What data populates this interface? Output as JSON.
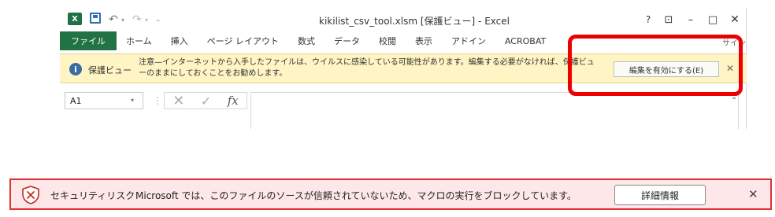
{
  "window": {
    "title": "kikilist_csv_tool.xlsm  [保護ビュー] - Excel",
    "help": "?",
    "ribbon_options": "⊡",
    "minimize": "–",
    "maximize": "□",
    "close": "✕"
  },
  "qat": {
    "app_icon": "X",
    "undo": "↶",
    "redo": "↷",
    "dropdown": "▾",
    "customize": "₌"
  },
  "tabs": [
    "ファイル",
    "ホーム",
    "挿入",
    "ページ レイアウト",
    "数式",
    "データ",
    "校閲",
    "表示",
    "アドイン",
    "ACROBAT"
  ],
  "signin_label": "サイン",
  "protected_view": {
    "icon": "i",
    "title": "保護ビュー",
    "message": "注意—インターネットから入手したファイルは、ウイルスに感染している可能性があります。編集する必要がなければ、保護ビューのままにしておくことをお勧めします。",
    "enable_button": "編集を有効にする(E)",
    "close": "✕"
  },
  "formula_bar": {
    "name_box": "A1",
    "dropdown": "▾",
    "separator": "⋮",
    "cancel": "✕",
    "enter": "✓",
    "fx": "fx",
    "collapse": "⌃"
  },
  "security_risk": {
    "title": "セキュリティリスク",
    "message": "Microsoft では、このファイルのソースが信頼されていないため、マクロの実行をブロックしています。",
    "details_button": "詳細情報",
    "close": "✕"
  },
  "colors": {
    "excel_green": "#217346",
    "protected_bar": "#fff4c4",
    "security_bar": "#fde7e9",
    "security_border": "#e0302f",
    "highlight": "#ee0000"
  }
}
